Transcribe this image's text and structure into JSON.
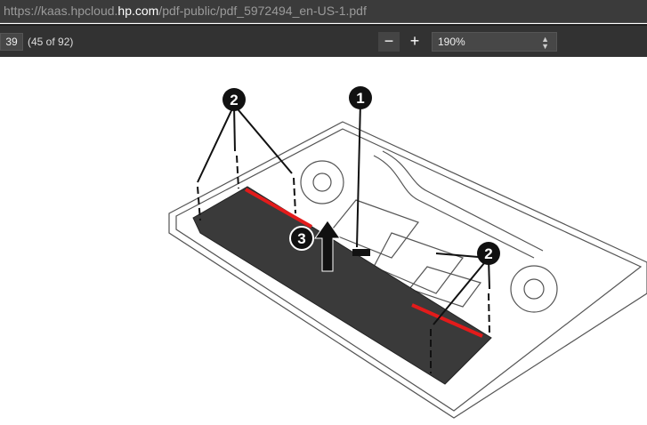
{
  "url": {
    "prefix": "https://kaas.hpcloud.",
    "host": "hp.com",
    "path": "/pdf-public/pdf_5972494_en-US-1.pdf"
  },
  "toolbar": {
    "page_number": "39",
    "page_count": "(45 of 92)",
    "zoom_out": "−",
    "zoom_in": "+",
    "zoom_value": "190%"
  },
  "figure": {
    "callouts": [
      "1",
      "2",
      "2",
      "3"
    ],
    "highlight_color": "#e31b1b",
    "battery_color": "#3a3a3a"
  }
}
